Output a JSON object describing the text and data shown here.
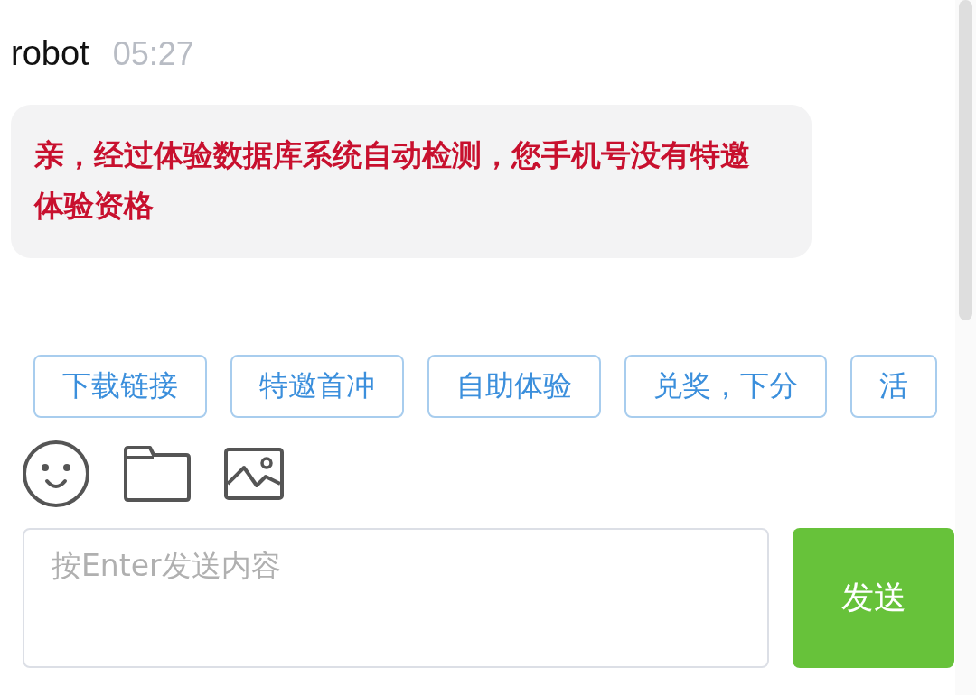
{
  "messages": [
    {
      "sender": "robot",
      "time": "05:27",
      "text": "亲，经过体验数据库系统自动检测，您手机号没有特邀体验资格"
    }
  ],
  "quick_replies": [
    "下载链接",
    "特邀首冲",
    "自助体验",
    "兑奖，下分",
    "活"
  ],
  "input": {
    "placeholder": "按Enter发送内容"
  },
  "send_button": "发送"
}
